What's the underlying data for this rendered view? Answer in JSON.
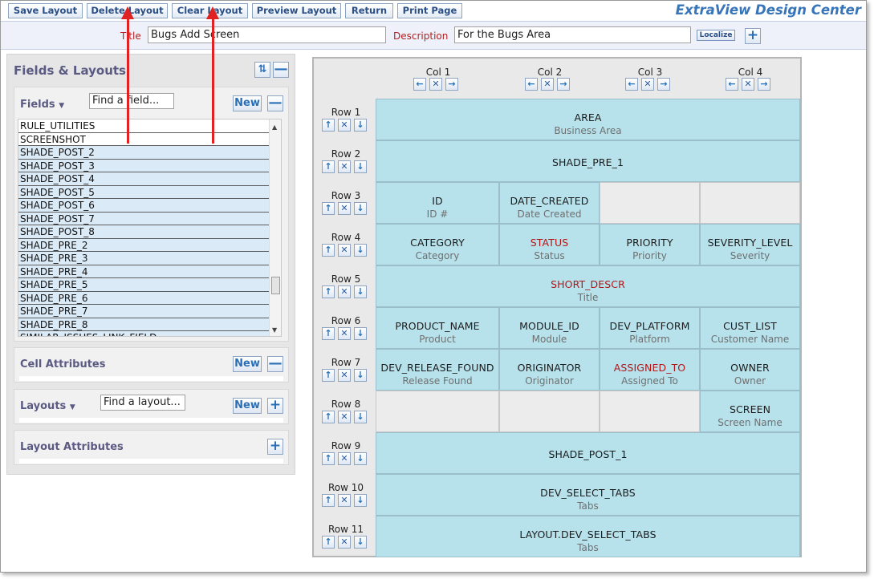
{
  "toolbar": {
    "buttons": [
      "Save Layout",
      "Delete Layout",
      "Clear Layout",
      "Preview Layout",
      "Return",
      "Print Page"
    ],
    "brand": "ExtraView Design Center"
  },
  "header": {
    "title_label": "Title",
    "title_value": "Bugs Add Screen",
    "description_label": "Description",
    "description_value": "For the Bugs Area",
    "localize_label": "Localize",
    "add_symbol": "+"
  },
  "sidebar": {
    "title": "Fields & Layouts",
    "refresh_symbol": "⇅",
    "collapse_symbol": "—",
    "fields": {
      "label": "Fields",
      "caret": "▼",
      "find_placeholder": "Find a field...",
      "new_label": "New",
      "minus_symbol": "—",
      "items": [
        "RULE_UTILITIES",
        "SCREENSHOT",
        "SHADE_POST_2",
        "SHADE_POST_3",
        "SHADE_POST_4",
        "SHADE_POST_5",
        "SHADE_POST_6",
        "SHADE_POST_7",
        "SHADE_POST_8",
        "SHADE_PRE_2",
        "SHADE_PRE_3",
        "SHADE_PRE_4",
        "SHADE_PRE_5",
        "SHADE_PRE_6",
        "SHADE_PRE_7",
        "SHADE_PRE_8",
        "SIMILAR_ISSUES_LINK_FIELD"
      ],
      "scroll_up": "▲",
      "scroll_down": "▼"
    },
    "cell_attributes": {
      "label": "Cell Attributes",
      "new_label": "New",
      "minus_symbol": "—"
    },
    "layouts": {
      "label": "Layouts",
      "caret": "▼",
      "find_placeholder": "Find a layout...",
      "new_label": "New",
      "plus_symbol": "+"
    },
    "layout_attributes": {
      "label": "Layout Attributes",
      "plus_symbol": "+"
    }
  },
  "controls": {
    "left": "←",
    "remove": "✕",
    "right": "→",
    "up": "↑",
    "down": "↓"
  },
  "grid": {
    "columns": [
      "Col 1",
      "Col 2",
      "Col 3",
      "Col 4"
    ],
    "rows": [
      {
        "label": "Row 1",
        "cells": [
          {
            "name": "AREA",
            "title": "Business Area"
          }
        ]
      },
      {
        "label": "Row 2",
        "cells": [
          {
            "name": "SHADE_PRE_1",
            "title": ""
          }
        ]
      },
      {
        "label": "Row 3",
        "cells": [
          {
            "name": "ID",
            "title": "ID #"
          },
          {
            "name": "DATE_CREATED",
            "title": "Date Created"
          },
          {
            "empty": true
          },
          {
            "empty": true
          }
        ]
      },
      {
        "label": "Row 4",
        "cells": [
          {
            "name": "CATEGORY",
            "title": "Category"
          },
          {
            "name": "STATUS",
            "title": "Status",
            "required": true
          },
          {
            "name": "PRIORITY",
            "title": "Priority"
          },
          {
            "name": "SEVERITY_LEVEL",
            "title": "Severity"
          }
        ]
      },
      {
        "label": "Row 5",
        "cells": [
          {
            "name": "SHORT_DESCR",
            "title": "Title",
            "required": true
          }
        ]
      },
      {
        "label": "Row 6",
        "cells": [
          {
            "name": "PRODUCT_NAME",
            "title": "Product"
          },
          {
            "name": "MODULE_ID",
            "title": "Module"
          },
          {
            "name": "DEV_PLATFORM",
            "title": "Platform"
          },
          {
            "name": "CUST_LIST",
            "title": "Customer Name"
          }
        ]
      },
      {
        "label": "Row 7",
        "cells": [
          {
            "name": "DEV_RELEASE_FOUND",
            "title": "Release Found"
          },
          {
            "name": "ORIGINATOR",
            "title": "Originator"
          },
          {
            "name": "ASSIGNED_TO",
            "title": "Assigned To",
            "required": true
          },
          {
            "name": "OWNER",
            "title": "Owner"
          }
        ]
      },
      {
        "label": "Row 8",
        "cells": [
          {
            "empty": true
          },
          {
            "empty": true
          },
          {
            "empty": true
          },
          {
            "name": "SCREEN",
            "title": "Screen Name"
          }
        ]
      },
      {
        "label": "Row 9",
        "cells": [
          {
            "name": "SHADE_POST_1",
            "title": ""
          }
        ]
      },
      {
        "label": "Row 10",
        "cells": [
          {
            "name": "DEV_SELECT_TABS",
            "title": "Tabs"
          }
        ]
      },
      {
        "label": "Row 11",
        "cells": [
          {
            "name": "LAYOUT.DEV_SELECT_TABS",
            "title": "Tabs"
          }
        ]
      }
    ]
  },
  "colors": {
    "cell_bg": "#b7e2ec",
    "required_text": "#b01818",
    "brand": "#3775b8",
    "annotation": "#e02222"
  }
}
